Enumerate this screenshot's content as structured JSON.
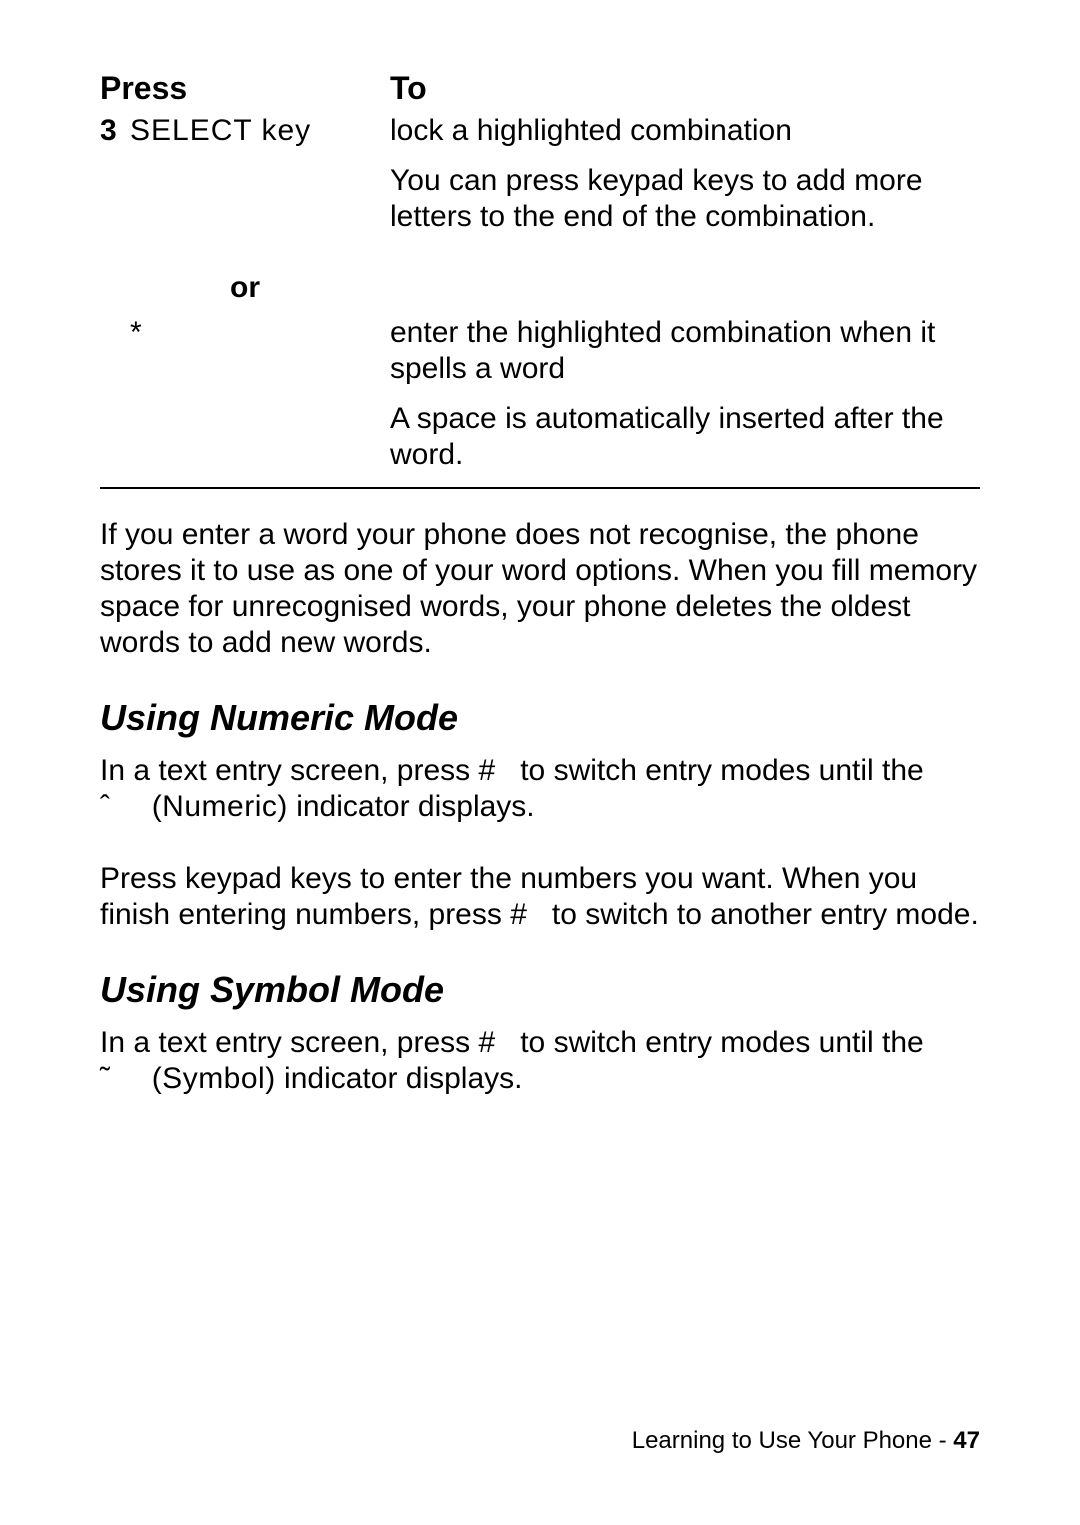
{
  "table": {
    "header_press": "Press",
    "header_to": "To",
    "row1": {
      "num": "3",
      "press": "SELECT key",
      "to": "lock a highlighted combination",
      "to_note": " You can press keypad keys to add more letters to the end of the combination."
    },
    "or": "or",
    "row2": {
      "press": "*",
      "to": "enter the highlighted combination when it spells a word",
      "to_note": "A space is automatically inserted after the word."
    }
  },
  "para1": "If you enter a word your phone does not recognise, the phone stores it to use as one of your word options. When you fill memory space for unrecognised words, your phone deletes the oldest words to add new words.",
  "h_numeric": "Using Numeric Mode",
  "numeric_p1_a": "In a text entry screen, press ",
  "numeric_p1_hash": "#",
  "numeric_p1_b": " to switch entry modes until the ",
  "numeric_sym": "ˆ",
  "numeric_label": "(Numeric)",
  "numeric_p1_c": " indicator displays.",
  "numeric_p2_a": "Press keypad keys to enter the numbers you want. When you finish entering numbers, press ",
  "numeric_p2_hash": "#",
  "numeric_p2_b": " to switch to another entry mode.",
  "h_symbol": "Using Symbol Mode",
  "symbol_p1_a": "In a text entry screen, press ",
  "symbol_p1_hash": "#",
  "symbol_p1_b": " to switch entry modes until the ",
  "symbol_sym": "˜",
  "symbol_label": "(Symbol)",
  "symbol_p1_c": " indicator displays.",
  "footer_text": "Learning to Use Your Phone - ",
  "footer_page": "47"
}
